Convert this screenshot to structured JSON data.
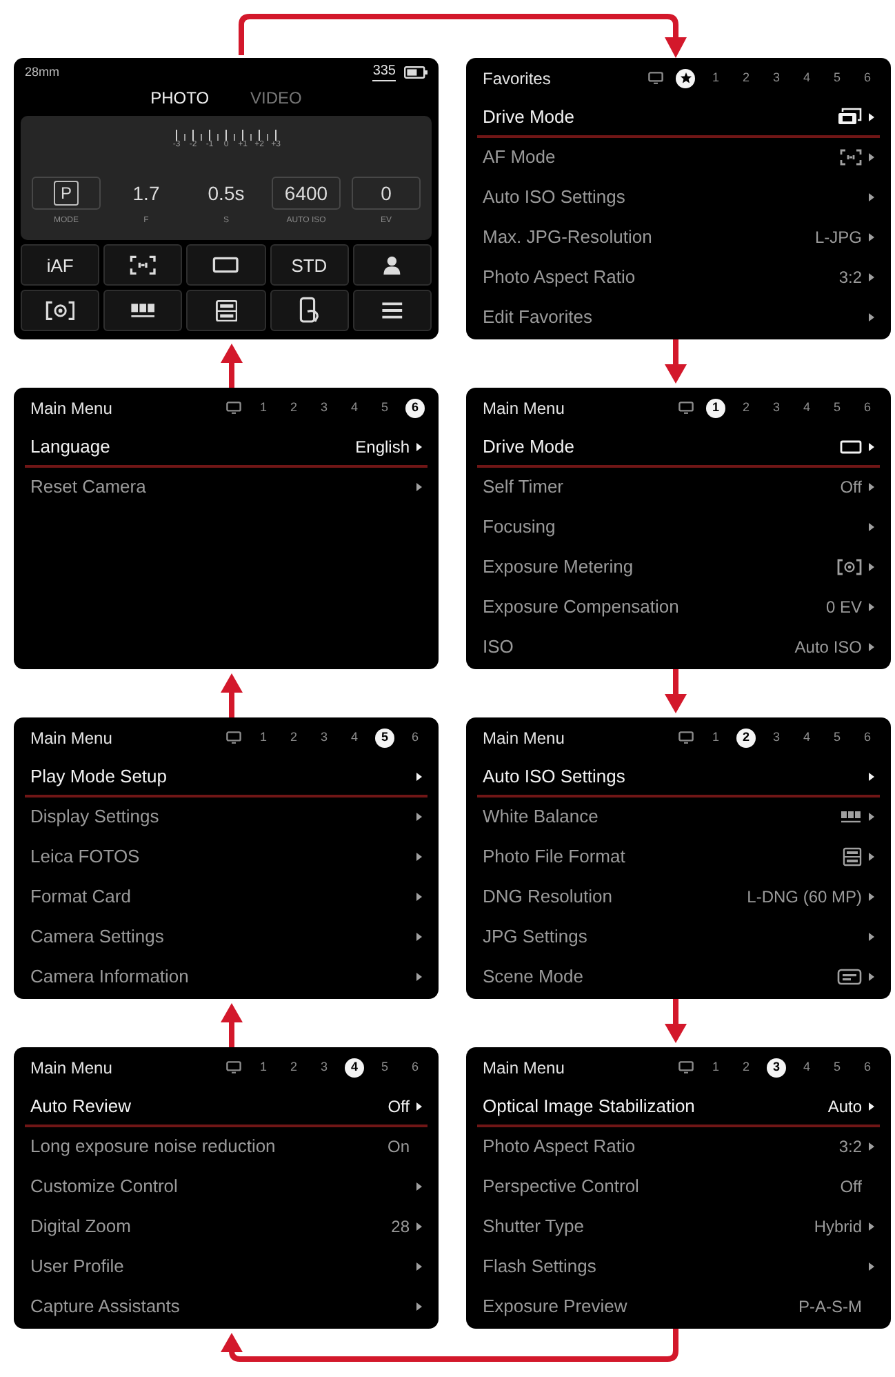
{
  "live_view": {
    "focal_length": "28mm",
    "shots_remaining": "335",
    "modes": [
      {
        "label": "PHOTO",
        "selected": true
      },
      {
        "label": "VIDEO",
        "selected": false
      }
    ],
    "exposure_scale": [
      "-3",
      "-2",
      "-1",
      "0",
      "+1",
      "+2",
      "+3"
    ],
    "settings": [
      {
        "kind": "mode",
        "value": "P",
        "label": "MODE",
        "framed": true
      },
      {
        "kind": "plain",
        "value": "1.7",
        "label": "F",
        "framed": false
      },
      {
        "kind": "plain",
        "value": "0.5s",
        "label": "S",
        "framed": false
      },
      {
        "kind": "plain",
        "value": "6400",
        "label": "AUTO ISO",
        "framed": true
      },
      {
        "kind": "plain",
        "value": "0",
        "label": "EV",
        "framed": true
      }
    ],
    "tiles": [
      {
        "kind": "text",
        "label": "iAF"
      },
      {
        "kind": "focusfield"
      },
      {
        "kind": "frame"
      },
      {
        "kind": "text",
        "label": "STD"
      },
      {
        "kind": "profile"
      },
      {
        "kind": "metering"
      },
      {
        "kind": "whitebalance"
      },
      {
        "kind": "fileformat"
      },
      {
        "kind": "phone"
      },
      {
        "kind": "menu"
      }
    ]
  },
  "menus": [
    {
      "title": "Favorites",
      "tabs": [
        {
          "kind": "icon",
          "selected": false
        },
        {
          "kind": "star",
          "selected": true
        },
        {
          "kind": "number",
          "label": "1",
          "selected": false
        },
        {
          "kind": "number",
          "label": "2",
          "selected": false
        },
        {
          "kind": "number",
          "label": "3",
          "selected": false
        },
        {
          "kind": "number",
          "label": "4",
          "selected": false
        },
        {
          "kind": "number",
          "label": "5",
          "selected": false
        },
        {
          "kind": "number",
          "label": "6",
          "selected": false
        }
      ],
      "rows": [
        {
          "label": "Drive Mode",
          "kind": "burst",
          "submenu": true,
          "selected": true
        },
        {
          "label": "AF Mode",
          "kind": "focusfield",
          "submenu": true,
          "selected": false
        },
        {
          "label": "Auto ISO Settings",
          "kind": "none",
          "submenu": true,
          "selected": false
        },
        {
          "label": "Max. JPG-Resolution",
          "kind": "text",
          "value": "L-JPG",
          "submenu": true,
          "selected": false
        },
        {
          "label": "Photo Aspect Ratio",
          "kind": "text",
          "value": "3:2",
          "submenu": true,
          "selected": false
        },
        {
          "label": "Edit Favorites",
          "kind": "none",
          "submenu": true,
          "selected": false
        }
      ]
    },
    {
      "title": "Main Menu",
      "tabs": [
        {
          "kind": "icon",
          "selected": false
        },
        {
          "kind": "number",
          "label": "1",
          "selected": false
        },
        {
          "kind": "number",
          "label": "2",
          "selected": false
        },
        {
          "kind": "number",
          "label": "3",
          "selected": false
        },
        {
          "kind": "number",
          "label": "4",
          "selected": false
        },
        {
          "kind": "number",
          "label": "5",
          "selected": false
        },
        {
          "kind": "number",
          "label": "6",
          "selected": true
        }
      ],
      "rows": [
        {
          "label": "Language",
          "kind": "text",
          "value": "English",
          "submenu": true,
          "selected": true
        },
        {
          "label": "Reset Camera",
          "kind": "none",
          "submenu": true,
          "selected": false
        }
      ]
    },
    {
      "title": "Main Menu",
      "tabs": [
        {
          "kind": "icon",
          "selected": false
        },
        {
          "kind": "number",
          "label": "1",
          "selected": true
        },
        {
          "kind": "number",
          "label": "2",
          "selected": false
        },
        {
          "kind": "number",
          "label": "3",
          "selected": false
        },
        {
          "kind": "number",
          "label": "4",
          "selected": false
        },
        {
          "kind": "number",
          "label": "5",
          "selected": false
        },
        {
          "kind": "number",
          "label": "6",
          "selected": false
        }
      ],
      "rows": [
        {
          "label": "Drive Mode",
          "kind": "frame",
          "submenu": true,
          "selected": true
        },
        {
          "label": "Self Timer",
          "kind": "text",
          "value": "Off",
          "submenu": true,
          "selected": false
        },
        {
          "label": "Focusing",
          "kind": "none",
          "submenu": true,
          "selected": false
        },
        {
          "label": "Exposure Metering",
          "kind": "metering",
          "submenu": true,
          "selected": false
        },
        {
          "label": "Exposure Compensation",
          "kind": "text",
          "value": "0 EV",
          "submenu": true,
          "selected": false
        },
        {
          "label": "ISO",
          "kind": "text",
          "value": "Auto ISO",
          "submenu": true,
          "selected": false
        }
      ]
    },
    {
      "title": "Main Menu",
      "tabs": [
        {
          "kind": "icon",
          "selected": false
        },
        {
          "kind": "number",
          "label": "1",
          "selected": false
        },
        {
          "kind": "number",
          "label": "2",
          "selected": false
        },
        {
          "kind": "number",
          "label": "3",
          "selected": false
        },
        {
          "kind": "number",
          "label": "4",
          "selected": false
        },
        {
          "kind": "number",
          "label": "5",
          "selected": true
        },
        {
          "kind": "number",
          "label": "6",
          "selected": false
        }
      ],
      "rows": [
        {
          "label": "Play Mode Setup",
          "kind": "none",
          "submenu": true,
          "selected": true
        },
        {
          "label": "Display Settings",
          "kind": "none",
          "submenu": true,
          "selected": false
        },
        {
          "label": "Leica FOTOS",
          "kind": "none",
          "submenu": true,
          "selected": false
        },
        {
          "label": "Format Card",
          "kind": "none",
          "submenu": true,
          "selected": false
        },
        {
          "label": "Camera Settings",
          "kind": "none",
          "submenu": true,
          "selected": false
        },
        {
          "label": "Camera Information",
          "kind": "none",
          "submenu": true,
          "selected": false
        }
      ]
    },
    {
      "title": "Main Menu",
      "tabs": [
        {
          "kind": "icon",
          "selected": false
        },
        {
          "kind": "number",
          "label": "1",
          "selected": false
        },
        {
          "kind": "number",
          "label": "2",
          "selected": true
        },
        {
          "kind": "number",
          "label": "3",
          "selected": false
        },
        {
          "kind": "number",
          "label": "4",
          "selected": false
        },
        {
          "kind": "number",
          "label": "5",
          "selected": false
        },
        {
          "kind": "number",
          "label": "6",
          "selected": false
        }
      ],
      "rows": [
        {
          "label": "Auto ISO Settings",
          "kind": "none",
          "submenu": true,
          "selected": true
        },
        {
          "label": "White Balance",
          "kind": "whitebalance",
          "submenu": true,
          "selected": false
        },
        {
          "label": "Photo File Format",
          "kind": "fileformat",
          "submenu": true,
          "selected": false
        },
        {
          "label": "DNG Resolution",
          "kind": "text",
          "value": "L-DNG (60 MP)",
          "submenu": true,
          "selected": false
        },
        {
          "label": "JPG Settings",
          "kind": "none",
          "submenu": true,
          "selected": false
        },
        {
          "label": "Scene Mode",
          "kind": "scene",
          "submenu": true,
          "selected": false
        }
      ]
    },
    {
      "title": "Main Menu",
      "tabs": [
        {
          "kind": "icon",
          "selected": false
        },
        {
          "kind": "number",
          "label": "1",
          "selected": false
        },
        {
          "kind": "number",
          "label": "2",
          "selected": false
        },
        {
          "kind": "number",
          "label": "3",
          "selected": false
        },
        {
          "kind": "number",
          "label": "4",
          "selected": true
        },
        {
          "kind": "number",
          "label": "5",
          "selected": false
        },
        {
          "kind": "number",
          "label": "6",
          "selected": false
        }
      ],
      "rows": [
        {
          "label": "Auto Review",
          "kind": "text",
          "value": "Off",
          "submenu": true,
          "selected": true
        },
        {
          "label": "Long exposure noise reduction",
          "kind": "text",
          "value": "On",
          "submenu": false,
          "selected": false
        },
        {
          "label": "Customize Control",
          "kind": "none",
          "submenu": true,
          "selected": false
        },
        {
          "label": "Digital Zoom",
          "kind": "text",
          "value": "28",
          "submenu": true,
          "selected": false
        },
        {
          "label": "User Profile",
          "kind": "none",
          "submenu": true,
          "selected": false
        },
        {
          "label": "Capture Assistants",
          "kind": "none",
          "submenu": true,
          "selected": false
        }
      ]
    },
    {
      "title": "Main Menu",
      "tabs": [
        {
          "kind": "icon",
          "selected": false
        },
        {
          "kind": "number",
          "label": "1",
          "selected": false
        },
        {
          "kind": "number",
          "label": "2",
          "selected": false
        },
        {
          "kind": "number",
          "label": "3",
          "selected": true
        },
        {
          "kind": "number",
          "label": "4",
          "selected": false
        },
        {
          "kind": "number",
          "label": "5",
          "selected": false
        },
        {
          "kind": "number",
          "label": "6",
          "selected": false
        }
      ],
      "rows": [
        {
          "label": "Optical Image Stabilization",
          "kind": "text",
          "value": "Auto",
          "submenu": true,
          "selected": true
        },
        {
          "label": "Photo Aspect Ratio",
          "kind": "text",
          "value": "3:2",
          "submenu": true,
          "selected": false
        },
        {
          "label": "Perspective Control",
          "kind": "text",
          "value": "Off",
          "submenu": false,
          "selected": false
        },
        {
          "label": "Shutter Type",
          "kind": "text",
          "value": "Hybrid",
          "submenu": true,
          "selected": false
        },
        {
          "label": "Flash Settings",
          "kind": "none",
          "submenu": true,
          "selected": false
        },
        {
          "label": "Exposure Preview",
          "kind": "text",
          "value": "P-A-S-M",
          "submenu": false,
          "selected": false
        }
      ]
    }
  ]
}
